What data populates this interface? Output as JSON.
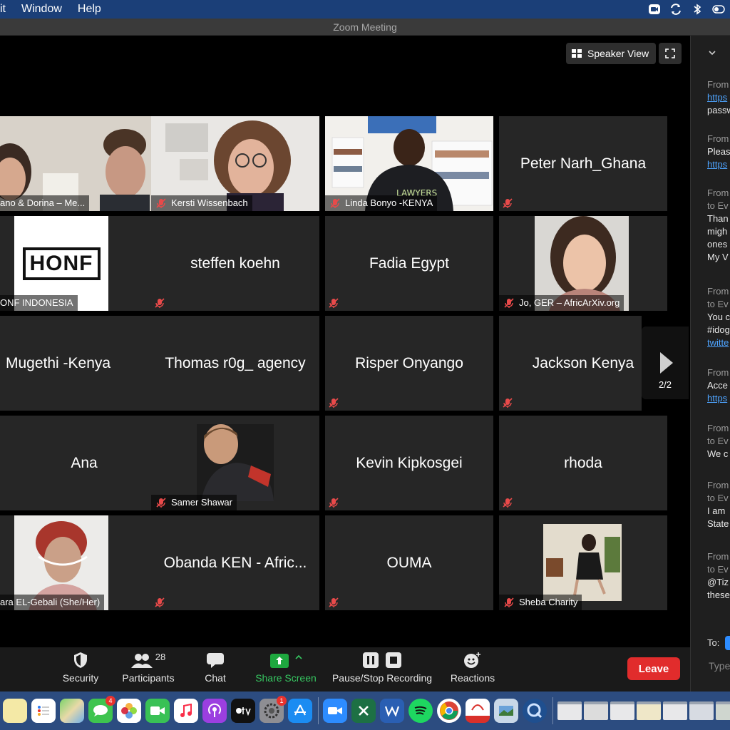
{
  "menubar": {
    "items": [
      "it",
      "Window",
      "Help"
    ]
  },
  "window": {
    "title": "Zoom Meeting"
  },
  "view": {
    "speaker_view_label": "Speaker View"
  },
  "gallery": {
    "page": "2/2",
    "tiles": [
      {
        "name": "ano & Dorina – Me...",
        "type": "photo"
      },
      {
        "name": "Kersti Wissenbach",
        "type": "photo"
      },
      {
        "name": "Linda Bonyo -KENYA",
        "type": "photo"
      },
      {
        "name": "Peter Narh_Ghana",
        "type": "text"
      },
      {
        "name": "ONF INDONESIA",
        "type": "logo",
        "logo_text": "HONF"
      },
      {
        "name": "steffen koehn",
        "type": "text"
      },
      {
        "name": "Fadia Egypt",
        "type": "text"
      },
      {
        "name": "Jo, GER – AfricArXiv.org",
        "type": "photo"
      },
      {
        "name": "Mugethi -Kenya",
        "type": "text"
      },
      {
        "name": "Thomas r0g_ agency",
        "type": "text"
      },
      {
        "name": "Risper Onyango",
        "type": "text"
      },
      {
        "name": "Jackson Kenya",
        "type": "text"
      },
      {
        "name": "Ana",
        "type": "text"
      },
      {
        "name": "Samer Shawar",
        "type": "photo"
      },
      {
        "name": "Kevin Kipkosgei",
        "type": "text"
      },
      {
        "name": "rhoda",
        "type": "text"
      },
      {
        "name": "ara EL-Gebali (She/Her)",
        "type": "photo"
      },
      {
        "name": "Obanda KEN - Afric...",
        "type": "text"
      },
      {
        "name": "OUMA",
        "type": "text"
      },
      {
        "name": "Sheba Charity",
        "type": "photo"
      }
    ]
  },
  "chat": {
    "messages": [
      {
        "from": "From",
        "lines": [
          {
            "t": "https",
            "link": true
          },
          {
            "t": "passw",
            "link": false
          }
        ]
      },
      {
        "from": "From",
        "lines": [
          {
            "t": "Pleas",
            "link": false
          },
          {
            "t": "https",
            "link": true
          }
        ]
      },
      {
        "from": "From",
        "to": "to Ev",
        "lines": [
          {
            "t": "Than",
            "link": false
          },
          {
            "t": "migh",
            "link": false
          },
          {
            "t": "ones",
            "link": false
          },
          {
            "t": "My V",
            "link": false
          }
        ]
      },
      {
        "from": "From",
        "to": "to Ev",
        "lines": [
          {
            "t": "You c",
            "link": false
          },
          {
            "t": "#idog",
            "link": false
          },
          {
            "t": "twitte",
            "link": true
          }
        ]
      },
      {
        "from": "From",
        "lines": [
          {
            "t": "Acce",
            "link": false
          },
          {
            "t": "https",
            "link": true
          }
        ]
      },
      {
        "from": "From",
        "to": "to Ev",
        "lines": [
          {
            "t": "We c",
            "link": false
          }
        ]
      },
      {
        "from": "From",
        "to": "to Ev",
        "lines": [
          {
            "t": "I am",
            "link": false
          },
          {
            "t": "State",
            "link": false
          }
        ]
      },
      {
        "from": "From",
        "to": "to Ev",
        "lines": [
          {
            "t": "@Tiz",
            "link": false
          },
          {
            "t": "these",
            "link": false
          }
        ]
      }
    ],
    "to_label": "To:",
    "type_placeholder": "Type"
  },
  "toolbar": {
    "security": "Security",
    "participants": "Participants",
    "participants_count": "28",
    "chat": "Chat",
    "share_screen": "Share Screen",
    "recording": "Pause/Stop Recording",
    "reactions": "Reactions",
    "leave": "Leave"
  },
  "dock": {
    "badges": {
      "messages": "4",
      "settings": "1"
    }
  },
  "colors": {
    "accent_green": "#36c761",
    "leave_red": "#e12c2c",
    "link_blue": "#4ea4ff",
    "tile_bg": "#262626"
  }
}
